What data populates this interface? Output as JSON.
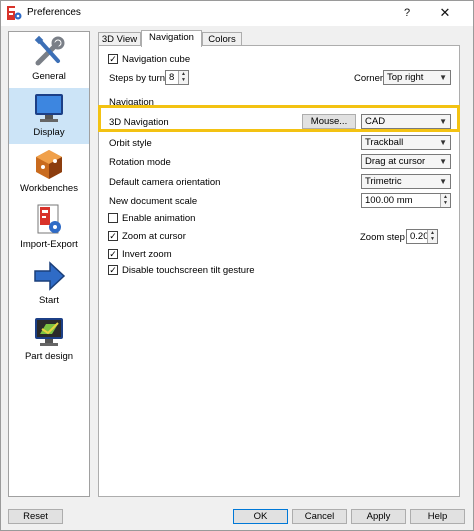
{
  "window": {
    "title": "Preferences",
    "help_glyph": "?",
    "close_glyph": "✕"
  },
  "sidebar": {
    "items": [
      {
        "label": "General",
        "icon": "wrench-screwdriver-icon"
      },
      {
        "label": "Display",
        "icon": "monitor-icon",
        "active": true
      },
      {
        "label": "Workbenches",
        "icon": "cube-icon"
      },
      {
        "label": "Import-Export",
        "icon": "document-gear-icon"
      },
      {
        "label": "Start",
        "icon": "arrow-right-icon"
      },
      {
        "label": "Part design",
        "icon": "part-design-icon"
      }
    ]
  },
  "tabs": [
    {
      "label": "3D View"
    },
    {
      "label": "Navigation",
      "active": true
    },
    {
      "label": "Colors"
    }
  ],
  "navigation_cube": {
    "label": "Navigation cube",
    "checked": true,
    "steps_label": "Steps by turn",
    "steps_value": "8",
    "corner_label": "Corner",
    "corner_value": "Top right"
  },
  "navigation": {
    "group_label": "Navigation",
    "nav3d_label": "3D Navigation",
    "mouse_button": "Mouse...",
    "nav3d_value": "CAD",
    "orbit_label": "Orbit style",
    "orbit_value": "Trackball",
    "rotation_label": "Rotation mode",
    "rotation_value": "Drag at cursor",
    "camera_label": "Default camera orientation",
    "camera_value": "Trimetric",
    "scale_label": "New document scale",
    "scale_value": "100.00 mm",
    "enable_animation_label": "Enable animation",
    "enable_animation_checked": false,
    "zoom_cursor_label": "Zoom at cursor",
    "zoom_cursor_checked": true,
    "zoom_step_label": "Zoom step",
    "zoom_step_value": "0.20",
    "invert_zoom_label": "Invert zoom",
    "invert_zoom_checked": true,
    "disable_tilt_label": "Disable touchscreen tilt gesture",
    "disable_tilt_checked": true
  },
  "buttons": {
    "reset": "Reset",
    "ok": "OK",
    "cancel": "Cancel",
    "apply": "Apply",
    "help": "Help"
  },
  "colors": {
    "highlight": "#f3c212",
    "selected_bg": "#cce4f7",
    "accent": "#0078d7"
  }
}
